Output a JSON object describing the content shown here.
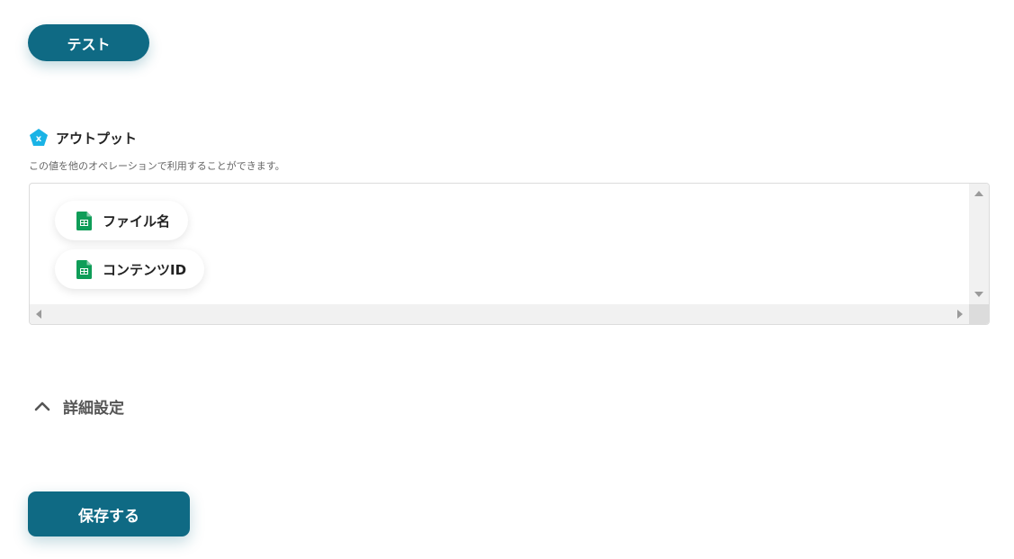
{
  "test_button": {
    "label": "テスト"
  },
  "output": {
    "title": "アウトプット",
    "icon": "output-variable-icon",
    "description": "この値を他のオペレーションで利用することができます。",
    "items": [
      {
        "label": "ファイル名",
        "icon": "google-sheets-icon"
      },
      {
        "label": "コンテンツID",
        "icon": "google-sheets-icon"
      }
    ]
  },
  "advanced_settings": {
    "label": "詳細設定",
    "icon": "chevron-up-icon"
  },
  "save_button": {
    "label": "保存する"
  },
  "colors": {
    "primary": "#0f6a84",
    "output_icon": "#1ab3e6",
    "sheets_green": "#0f9d58"
  }
}
